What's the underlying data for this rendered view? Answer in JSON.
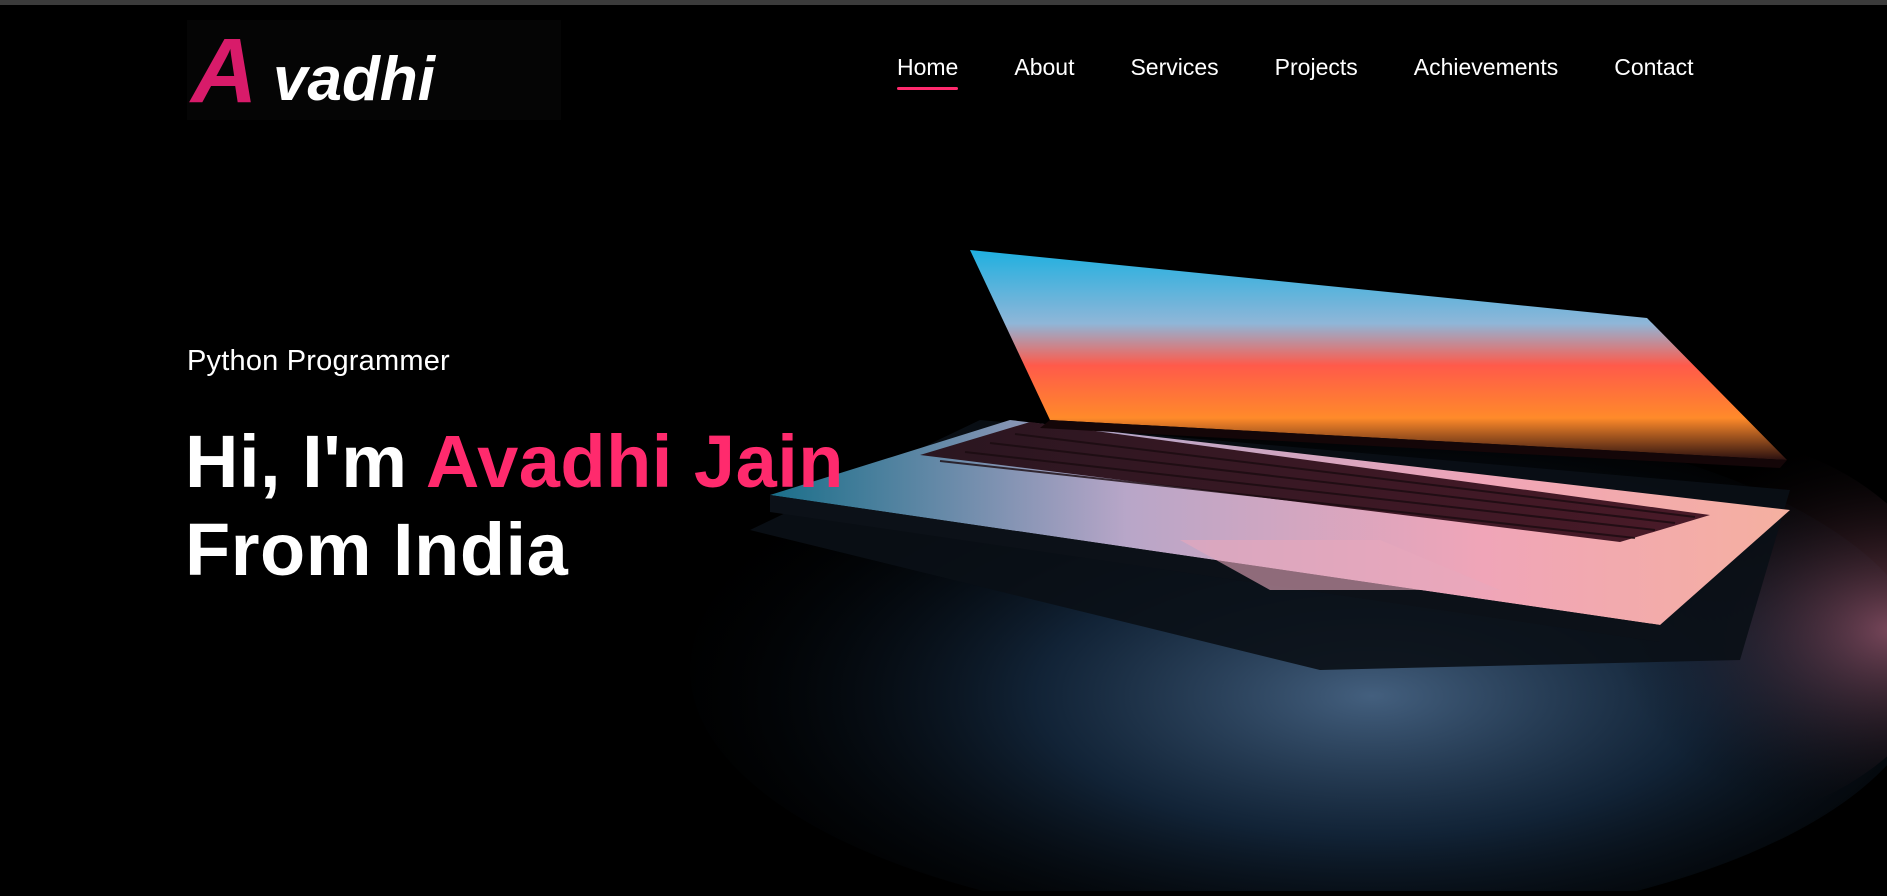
{
  "brand": {
    "logo_text": "Avadhi",
    "logo_first_letter": "A",
    "logo_rest": "vadhi",
    "accent_color": "#ff2a6d"
  },
  "nav": {
    "items": [
      {
        "label": "Home",
        "active": true
      },
      {
        "label": "About"
      },
      {
        "label": "Services"
      },
      {
        "label": "Projects"
      },
      {
        "label": "Achievements"
      },
      {
        "label": "Contact"
      }
    ]
  },
  "hero": {
    "subtitle": "Python Programmer",
    "greeting": "Hi, I'm",
    "name": "Avadhi Jain",
    "line2": "From India"
  }
}
